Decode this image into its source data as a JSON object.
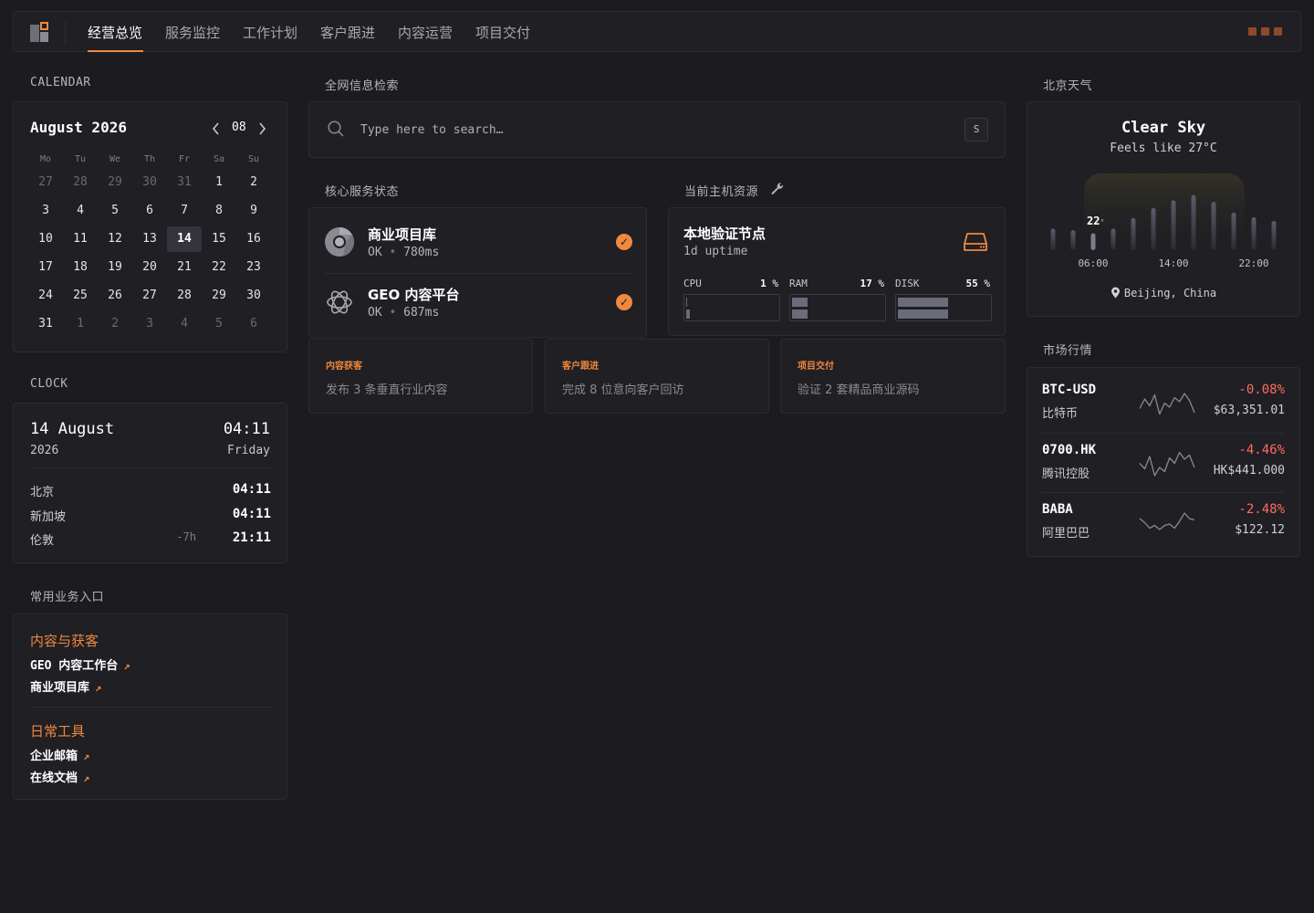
{
  "nav": {
    "tabs": [
      "经营总览",
      "服务监控",
      "工作计划",
      "客户跟进",
      "内容运营",
      "项目交付"
    ],
    "active_index": 0
  },
  "calendar": {
    "section_title": "CALENDAR",
    "title": "August 2026",
    "month_num": "08",
    "prev_icon": "chevron-left-icon",
    "next_icon": "chevron-right-icon",
    "weekdays": [
      "Mo",
      "Tu",
      "We",
      "Th",
      "Fr",
      "Sa",
      "Su"
    ],
    "weeks": [
      [
        "27",
        "28",
        "29",
        "30",
        "31",
        "1",
        "2"
      ],
      [
        "3",
        "4",
        "5",
        "6",
        "7",
        "8",
        "9"
      ],
      [
        "10",
        "11",
        "12",
        "13",
        "14",
        "15",
        "16"
      ],
      [
        "17",
        "18",
        "19",
        "20",
        "21",
        "22",
        "23"
      ],
      [
        "24",
        "25",
        "26",
        "27",
        "28",
        "29",
        "30"
      ],
      [
        "31",
        "1",
        "2",
        "3",
        "4",
        "5",
        "6"
      ]
    ],
    "today": "14"
  },
  "clock": {
    "section_title": "CLOCK",
    "date": "14 August",
    "year": "2026",
    "time": "04:11",
    "weekday": "Friday",
    "zones": [
      {
        "city": "北京",
        "offset": "",
        "time": "04:11"
      },
      {
        "city": "新加坡",
        "offset": "",
        "time": "04:11"
      },
      {
        "city": "伦敦",
        "offset": "-7h",
        "time": "21:11"
      }
    ]
  },
  "links": {
    "section_title": "常用业务入口",
    "groups": [
      {
        "title": "内容与获客",
        "items": [
          "GEO 内容工作台",
          "商业项目库"
        ]
      },
      {
        "title": "日常工具",
        "items": [
          "企业邮箱",
          "在线文档"
        ]
      }
    ],
    "arrow": "↗"
  },
  "search": {
    "section_title": "全网信息检索",
    "placeholder": "Type here to search…",
    "shortcut": "S"
  },
  "services": {
    "section_title": "核心服务状态",
    "items": [
      {
        "name": "商业项目库",
        "status": "OK",
        "latency": "780ms",
        "icon": "chrome-icon"
      },
      {
        "name": "GEO 内容平台",
        "status": "OK",
        "latency": "687ms",
        "icon": "openai-icon"
      }
    ],
    "separator": "•"
  },
  "host": {
    "section_title": "当前主机资源",
    "name": "本地验证节点",
    "uptime": "1d uptime",
    "metrics": [
      {
        "label": "CPU",
        "percent": "1",
        "value": 1
      },
      {
        "label": "RAM",
        "percent": "17",
        "value": 17
      },
      {
        "label": "DISK",
        "percent": "55",
        "value": 55
      }
    ],
    "unit": "%"
  },
  "tasks": [
    {
      "tag": "内容获客",
      "desc": "发布 3 条垂直行业内容"
    },
    {
      "tag": "客户跟进",
      "desc": "完成 8 位意向客户回访"
    },
    {
      "tag": "项目交付",
      "desc": "验证 2 套精品商业源码"
    }
  ],
  "weather": {
    "section_title": "北京天气",
    "condition": "Clear Sky",
    "feels_like": "Feels like 27°C",
    "current_temp": "22",
    "current_unit": "°",
    "hour_labels": [
      "06:00",
      "14:00",
      "22:00"
    ],
    "location": "Beijing, China",
    "bar_levels": [
      0.28,
      0.26,
      0.22,
      0.28,
      0.42,
      0.55,
      0.65,
      0.72,
      0.63,
      0.49,
      0.43,
      0.38
    ]
  },
  "market": {
    "section_title": "市场行情",
    "items": [
      {
        "symbol": "BTC-USD",
        "name": "比特币",
        "change": "-0.08%",
        "price": "$63,351.01",
        "spark": [
          0.35,
          0.7,
          0.45,
          0.85,
          0.15,
          0.55,
          0.4,
          0.75,
          0.6,
          0.9,
          0.65,
          0.2
        ]
      },
      {
        "symbol": "0700.HK",
        "name": "腾讯控股",
        "change": "-4.46%",
        "price": "HK$441.000",
        "spark": [
          0.55,
          0.35,
          0.8,
          0.1,
          0.4,
          0.25,
          0.75,
          0.55,
          0.95,
          0.7,
          0.85,
          0.4
        ]
      },
      {
        "symbol": "BABA",
        "name": "阿里巴巴",
        "change": "-2.48%",
        "price": "$122.12",
        "spark": [
          0.7,
          0.55,
          0.35,
          0.45,
          0.3,
          0.45,
          0.5,
          0.35,
          0.6,
          0.9,
          0.7,
          0.65
        ]
      }
    ]
  },
  "colors": {
    "accent": "#f0883e",
    "negative": "#ff6b5e",
    "background": "#1c1c20",
    "panel": "#1f1f24"
  }
}
